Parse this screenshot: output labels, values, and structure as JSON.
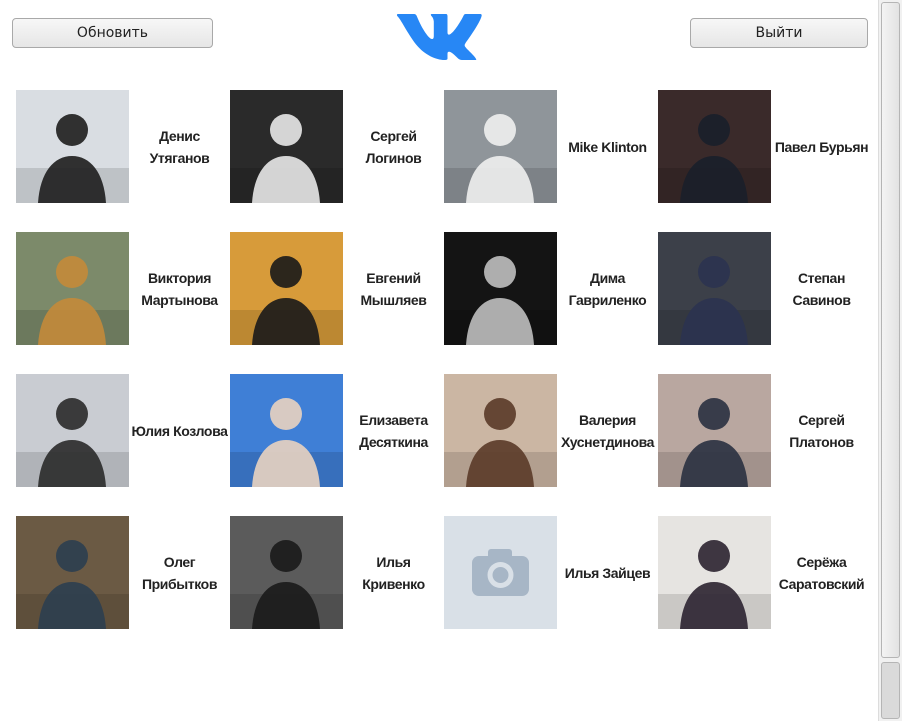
{
  "toolbar": {
    "refresh_label": "Обновить",
    "logout_label": "Выйти"
  },
  "logo": {
    "icon": "vk-logo-icon",
    "color": "#2787F5"
  },
  "friends": [
    {
      "name": "Денис\nУтяганов",
      "photo": "outdoor-crowd",
      "bg": "#d9dde2",
      "fg": "#1d1d1d"
    },
    {
      "name": "Сергей\nЛогинов",
      "photo": "white-mask",
      "bg": "#2a2a2a",
      "fg": "#e8e8e8"
    },
    {
      "name": "Mike Klinton",
      "photo": "sea-sky",
      "bg": "#8f959a",
      "fg": "#f0f0f0"
    },
    {
      "name": "Павел Бурьян",
      "photo": "night-red",
      "bg": "#3a2a2a",
      "fg": "#1a1f2a"
    },
    {
      "name": "Виктория\nМартынова",
      "photo": "girl-orange",
      "bg": "#7c8a6a",
      "fg": "#c48a3a"
    },
    {
      "name": "Евгений\nМышляев",
      "photo": "black-mask",
      "bg": "#d79b3a",
      "fg": "#1a1a1a"
    },
    {
      "name": "Дима\nГавриленко",
      "photo": "dark-room",
      "bg": "#141414",
      "fg": "#bfbfbf"
    },
    {
      "name": "Степан\nСавинов",
      "photo": "city-lights",
      "bg": "#3c4049",
      "fg": "#2b3350"
    },
    {
      "name": "Юлия Козлова",
      "photo": "city-girl",
      "bg": "#c9ccd2",
      "fg": "#2a2a2a"
    },
    {
      "name": "Елизавета\nДесяткина",
      "photo": "blue-sky",
      "bg": "#3f7fd6",
      "fg": "#e9d3c0"
    },
    {
      "name": "Валерия\nХуснетдинова",
      "photo": "portrait-warm",
      "bg": "#cbb6a3",
      "fg": "#5a3a28"
    },
    {
      "name": "Сергей\nПлатонов",
      "photo": "sunset-river",
      "bg": "#b9a7a0",
      "fg": "#2a3140"
    },
    {
      "name": "Олег\nПрибытков",
      "photo": "table-smoke",
      "bg": "#6b5a44",
      "fg": "#2c3e50"
    },
    {
      "name": "Илья\nКривенко",
      "photo": "bw-street",
      "bg": "#5b5b5b",
      "fg": "#1a1a1a"
    },
    {
      "name": "Илья Зайцев",
      "photo": "camera-placeholder",
      "bg": "#d9e0e7",
      "fg": "#a7b6c6"
    },
    {
      "name": "Серёжа\nСаратовский",
      "photo": "mirror-selfie",
      "bg": "#e6e4e1",
      "fg": "#2b2230"
    }
  ]
}
